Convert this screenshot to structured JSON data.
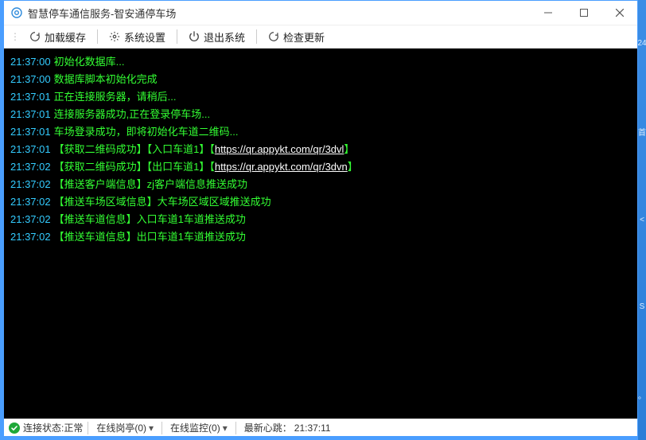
{
  "titlebar": {
    "title": "智慧停车通信服务-智安通停车场"
  },
  "toolbar": {
    "load_cache": "加载缓存",
    "system_settings": "系统设置",
    "exit_system": "退出系统",
    "check_update": "检查更新"
  },
  "log": {
    "lines": [
      {
        "ts": "21:37:00",
        "parts": [
          {
            "text": "初始化数据库..."
          }
        ]
      },
      {
        "ts": "21:37:00",
        "parts": [
          {
            "text": "数据库脚本初始化完成"
          }
        ]
      },
      {
        "ts": "21:37:01",
        "parts": [
          {
            "text": "正在连接服务器，请稍后..."
          }
        ]
      },
      {
        "ts": "21:37:01",
        "parts": [
          {
            "text": "连接服务器成功,正在登录停车场..."
          }
        ]
      },
      {
        "ts": "21:37:01",
        "parts": [
          {
            "text": "车场登录成功，即将初始化车道二维码..."
          }
        ]
      },
      {
        "ts": "21:37:01",
        "parts": [
          {
            "text": "【获取二维码成功】【入口车道1】【"
          },
          {
            "text": "https://qr.appykt.com/qr/3dvl",
            "link": true
          },
          {
            "text": "】"
          }
        ]
      },
      {
        "ts": "21:37:02",
        "parts": [
          {
            "text": "【获取二维码成功】【出口车道1】【"
          },
          {
            "text": "https://qr.appykt.com/qr/3dvn",
            "link": true
          },
          {
            "text": "】"
          }
        ]
      },
      {
        "ts": "21:37:02",
        "parts": [
          {
            "text": "【推送客户端信息】zj客户端信息推送成功"
          }
        ]
      },
      {
        "ts": "21:37:02",
        "parts": [
          {
            "text": "【推送车场区域信息】大车场区域区域推送成功"
          }
        ]
      },
      {
        "ts": "21:37:02",
        "parts": [
          {
            "text": "【推送车道信息】入口车道1车道推送成功"
          }
        ]
      },
      {
        "ts": "21:37:02",
        "parts": [
          {
            "text": "【推送车道信息】出口车道1车道推送成功"
          }
        ]
      }
    ]
  },
  "statusbar": {
    "connection": "连接状态:正常",
    "online_sentry": "在线岗亭(0)",
    "online_monitor": "在线监控(0)",
    "heartbeat_label": "最新心跳：",
    "heartbeat_time": "21:37:11"
  }
}
